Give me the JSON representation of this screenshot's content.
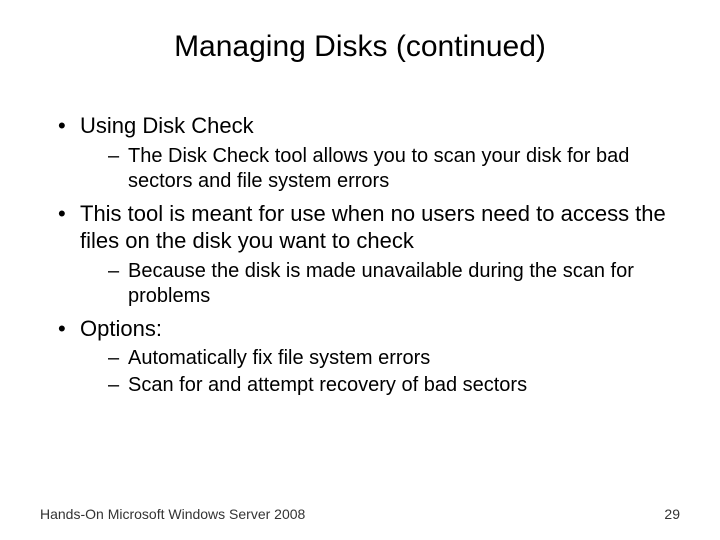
{
  "title": "Managing Disks (continued)",
  "bullets": {
    "b1": "Using Disk Check",
    "b1_sub1": "The Disk Check tool allows you to scan your disk for bad sectors and file system errors",
    "b2": "This tool is meant for use when no users need to access the files on the disk you want to check",
    "b2_sub1": "Because the disk is made unavailable during the scan for problems",
    "b3": "Options:",
    "b3_sub1": "Automatically fix file system errors",
    "b3_sub2": "Scan for and attempt recovery of bad sectors"
  },
  "footer": {
    "source": "Hands-On Microsoft Windows Server 2008",
    "page": "29"
  }
}
